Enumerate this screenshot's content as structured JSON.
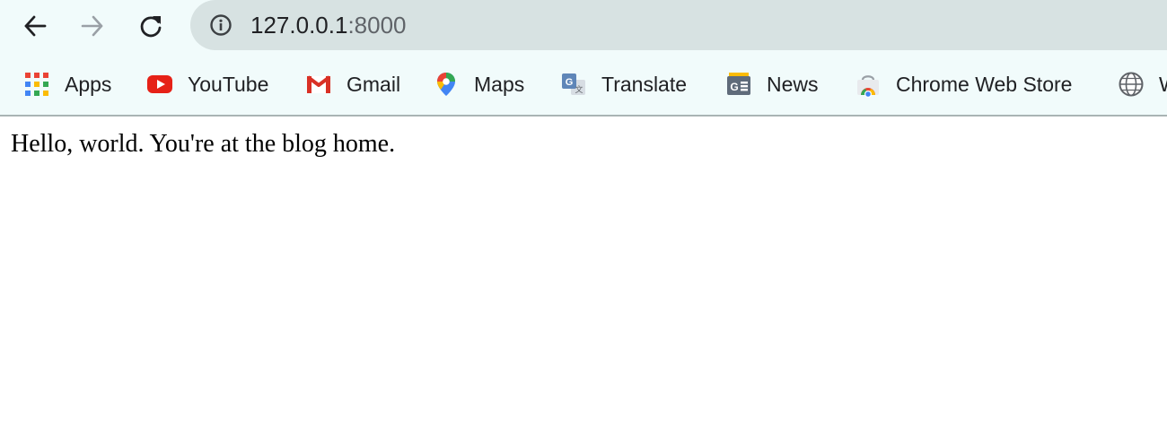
{
  "browser": {
    "nav": {
      "back_icon": "arrow-left-icon",
      "forward_icon": "arrow-right-icon",
      "reload_icon": "reload-icon"
    },
    "omnibox": {
      "info_icon": "info-icon",
      "host": "127.0.0.1",
      "port": ":8000"
    },
    "bookmarks": [
      {
        "label": "Apps",
        "icon": "apps-grid-icon"
      },
      {
        "label": "YouTube",
        "icon": "youtube-icon"
      },
      {
        "label": "Gmail",
        "icon": "gmail-icon"
      },
      {
        "label": "Maps",
        "icon": "maps-pin-icon"
      },
      {
        "label": "Translate",
        "icon": "translate-icon"
      },
      {
        "label": "News",
        "icon": "news-icon"
      },
      {
        "label": "Chrome Web Store",
        "icon": "web-store-icon"
      },
      {
        "label": "W",
        "icon": "globe-icon"
      }
    ]
  },
  "page": {
    "text": "Hello, world. You're at the blog home."
  },
  "colors": {
    "toolbar_bg": "#f1fbfb",
    "omnibox_bg": "#d7e2e2",
    "divider": "#a9b4b4"
  }
}
